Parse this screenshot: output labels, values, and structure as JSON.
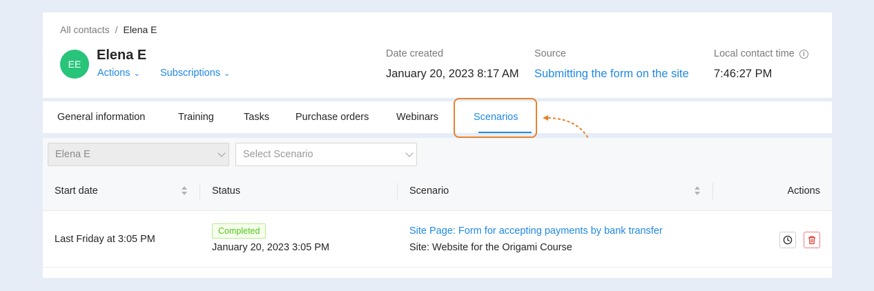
{
  "breadcrumb": {
    "parent": "All contacts",
    "separator": "/",
    "current": "Elena E"
  },
  "contact": {
    "initials": "EE",
    "name": "Elena E",
    "avatar_color": "#27c47a",
    "actions_label": "Actions",
    "subscriptions_label": "Subscriptions"
  },
  "meta": {
    "date_created": {
      "label": "Date created",
      "value": "January 20, 2023 8:17 AM"
    },
    "source": {
      "label": "Source",
      "value": "Submitting the form on the site"
    },
    "local_time": {
      "label": "Local contact time",
      "value": "7:46:27 PM"
    }
  },
  "tabs": [
    {
      "label": "General information"
    },
    {
      "label": "Training"
    },
    {
      "label": "Tasks"
    },
    {
      "label": "Purchase orders"
    },
    {
      "label": "Webinars"
    },
    {
      "label": "Scenarios",
      "active": true
    }
  ],
  "filters": {
    "contact_value": "Elena E",
    "scenario_placeholder": "Select Scenario"
  },
  "table": {
    "columns": [
      "Start date",
      "Status",
      "Scenario",
      "Actions"
    ],
    "rows": [
      {
        "start_date": "Last Friday at 3:05 PM",
        "status": "Completed",
        "status_date": "January 20, 2023 3:05 PM",
        "scenario_title": "Site Page: Form for accepting payments by bank transfer",
        "scenario_site": "Site: Website for the Origami Course"
      }
    ]
  },
  "colors": {
    "accent": "#1e88e5",
    "highlight": "#e8812c",
    "success": "#52c41a",
    "danger": "#f5222d"
  }
}
